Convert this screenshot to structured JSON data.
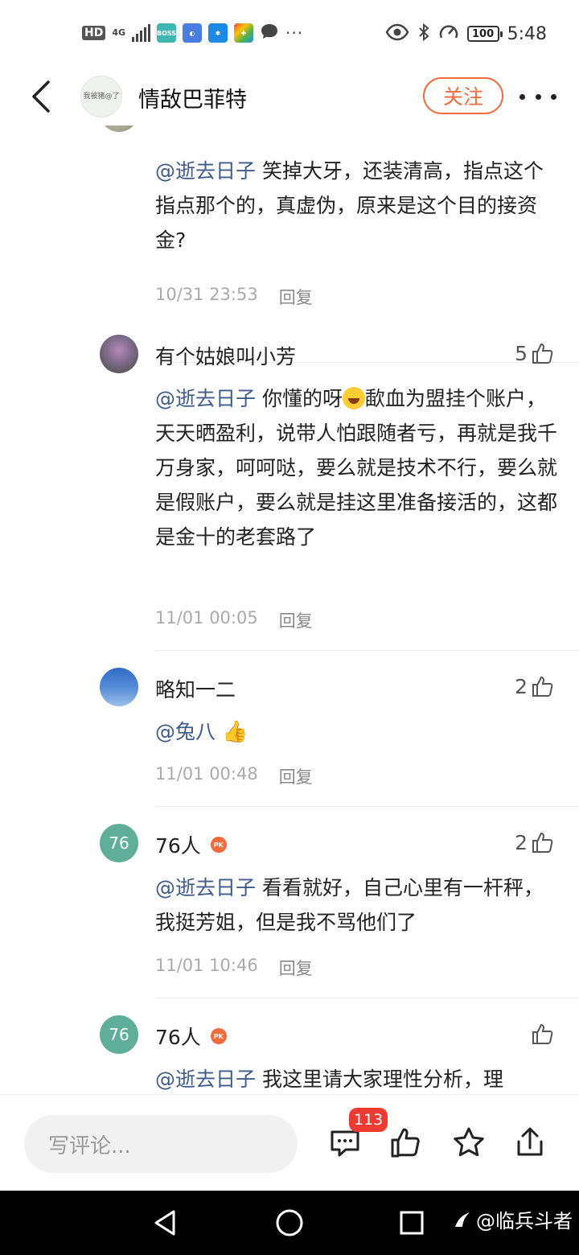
{
  "status_bar": {
    "hd": "HD",
    "network": "4G",
    "battery": "100",
    "time": "5:48",
    "app_icons": [
      "BOSS直聘",
      "browser-icon",
      "app-icon",
      "app-icon",
      "chat-icon"
    ],
    "more": "···"
  },
  "nav": {
    "title": "情敌巴菲特",
    "follow_label": "关注",
    "avatar_text": "我被猪@了"
  },
  "comments": [
    {
      "name": "",
      "likes": "",
      "mention": "@逝去日子",
      "text": "笑掉大牙，还装清高，指点这个指点那个的，真虚伪，原来是这个目的接资金?",
      "time": "10/31 23:53",
      "reply": "回复"
    },
    {
      "name": "有个姑娘叫小芳",
      "likes": "5",
      "mention": "@逝去日子",
      "text_a": "你懂的呀",
      "text_b": "歃血为盟挂个账户，天天晒盈利，说带人怕跟随者亏，再就是我千万身家，呵呵哒，要么就是技术不行，要么就是假账户，要么就是挂这里准备接活的，这都是金十的老套路了",
      "time": "11/01 00:05",
      "reply": "回复"
    },
    {
      "name": "略知一二",
      "likes": "2",
      "mention": "@兔八",
      "time": "11/01 00:48",
      "reply": "回复"
    },
    {
      "name": "76人",
      "avatar_text": "76",
      "likes": "2",
      "mention": "@逝去日子",
      "text": "看看就好，自己心里有一杆秤，我挺芳姐，但是我不骂他们了",
      "time": "11/01 10:46",
      "reply": "回复"
    },
    {
      "name": "76人",
      "avatar_text": "76",
      "likes": "",
      "mention": "@逝去日子",
      "text": "我这里请大家理性分析，理"
    }
  ],
  "bottom": {
    "placeholder": "写评论...",
    "comment_count": "113"
  },
  "watermark": "@临兵斗者",
  "colors": {
    "accent": "#f26b3a",
    "mention": "#3f5b8c",
    "badge": "#ee3a32"
  }
}
